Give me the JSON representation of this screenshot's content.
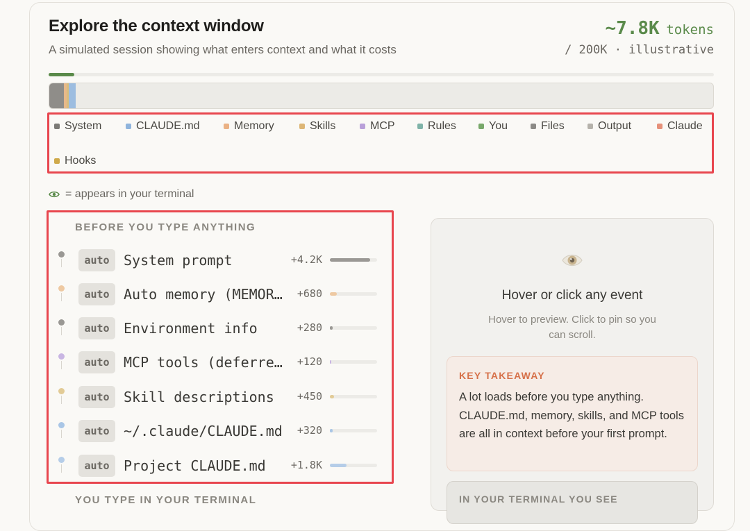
{
  "header": {
    "title": "Explore the context window",
    "subtitle": "A simulated session showing what enters context and what it costs",
    "token_value": "~7.8K",
    "token_unit": "tokens",
    "token_sub": "/ 200K · illustrative"
  },
  "progress": {
    "fraction": 0.039,
    "color": "#5a8a4a"
  },
  "segments": [
    {
      "category": "System",
      "tokens": 4480,
      "color": "#8f8d89"
    },
    {
      "category": "Memory",
      "tokens": 680,
      "color": "#e8b98a"
    },
    {
      "category": "Skills",
      "tokens": 450,
      "color": "#d9bd7e"
    },
    {
      "category": "CLAUDE.md",
      "tokens": 2120,
      "color": "#9dbde0"
    }
  ],
  "legend": [
    {
      "label": "System",
      "color": "#7c7a76",
      "icon": "square"
    },
    {
      "label": "CLAUDE.md",
      "color": "#8fb4dc",
      "icon": "square"
    },
    {
      "label": "Memory",
      "color": "#eab184",
      "icon": "square"
    },
    {
      "label": "Skills",
      "color": "#ddb676",
      "icon": "square"
    },
    {
      "label": "MCP",
      "color": "#b9a0d9",
      "icon": "square"
    },
    {
      "label": "Rules",
      "color": "#7fb3a8",
      "icon": "square"
    },
    {
      "label": "You",
      "color": "#78a86a",
      "icon": "square"
    },
    {
      "label": "Files",
      "color": "#8c8a86",
      "icon": "square"
    },
    {
      "label": "Output",
      "color": "#b5b2ab",
      "icon": "square"
    },
    {
      "label": "Claude",
      "color": "#e6917a",
      "icon": "square"
    },
    {
      "label": "Hooks",
      "color": "#cfa94a",
      "icon": "square"
    }
  ],
  "eye_note": {
    "icon": "eye-icon",
    "text": "= appears in your terminal"
  },
  "events_section": {
    "heading": "BEFORE YOU TYPE ANYTHING",
    "events": [
      {
        "badge": "auto",
        "name": "System prompt",
        "delta": "+4.2K",
        "fraction": 0.85,
        "color": "#9a9894"
      },
      {
        "badge": "auto",
        "name": "Auto memory (MEMORY.md)",
        "delta": "+680",
        "fraction": 0.14,
        "color": "#eec9a2"
      },
      {
        "badge": "auto",
        "name": "Environment info",
        "delta": "+280",
        "fraction": 0.06,
        "color": "#9a9894"
      },
      {
        "badge": "auto",
        "name": "MCP tools (deferred)",
        "delta": "+120",
        "fraction": 0.025,
        "color": "#c9b6e3"
      },
      {
        "badge": "auto",
        "name": "Skill descriptions",
        "delta": "+450",
        "fraction": 0.09,
        "color": "#e2cb96"
      },
      {
        "badge": "auto",
        "name": "~/.claude/CLAUDE.md",
        "delta": "+320",
        "fraction": 0.065,
        "color": "#a9c6e6"
      },
      {
        "badge": "auto",
        "name": "Project CLAUDE.md",
        "delta": "+1.8K",
        "fraction": 0.36,
        "color": "#b5cde8"
      }
    ]
  },
  "detail_panel": {
    "icon": "eye-icon",
    "title": "Hover or click any event",
    "subtitle": "Hover to preview. Click to pin so you can scroll.",
    "takeaway_heading": "KEY TAKEAWAY",
    "takeaway_body": "A lot loads before you type anything. CLAUDE.md, memory, skills, and MCP tools are all in context before your first prompt.",
    "terminal_heading": "IN YOUR TERMINAL YOU SEE"
  },
  "next_section": {
    "heading": "YOU TYPE IN YOUR TERMINAL"
  }
}
